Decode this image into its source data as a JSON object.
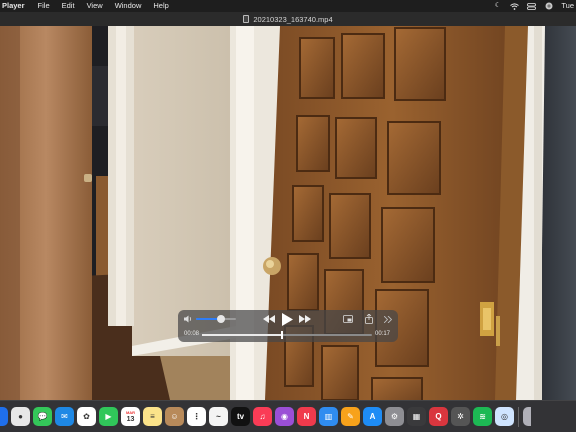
{
  "menubar": {
    "app_name": "Player",
    "menus": [
      "File",
      "Edit",
      "View",
      "Window",
      "Help"
    ],
    "status_icons": [
      "moon-icon",
      "wifi-icon",
      "control-center-icon",
      "siri-icon"
    ],
    "clock": "Tue"
  },
  "window": {
    "title": "20210323_163740.mp4"
  },
  "controller": {
    "volume_level": 0.62,
    "current_time": "00:08",
    "duration": "00:17",
    "progress": 0.47,
    "buttons": [
      "rewind-button",
      "play-button",
      "fast-forward-button",
      "picture-in-picture-button",
      "share-button",
      "more-button"
    ]
  },
  "dock": {
    "apps": [
      {
        "name": "finder-icon-partial",
        "color": "#1f6feb",
        "glyph": ""
      },
      {
        "name": "chrome-icon",
        "color": "#e8e8e8",
        "glyph": "●"
      },
      {
        "name": "messages-icon",
        "color": "#34c759",
        "glyph": "💬"
      },
      {
        "name": "mail-icon",
        "color": "#1e88e5",
        "glyph": "✉"
      },
      {
        "name": "photos-icon",
        "color": "#ffffff",
        "glyph": "✿"
      },
      {
        "name": "facetime-icon",
        "color": "#30c75a",
        "glyph": "▶"
      },
      {
        "name": "calendar-icon",
        "color": "#ffffff",
        "glyph": "13"
      },
      {
        "name": "notes-icon",
        "color": "#fbe38a",
        "glyph": "≡"
      },
      {
        "name": "contacts-icon",
        "color": "#b88a5a",
        "glyph": "☺"
      },
      {
        "name": "reminders-icon",
        "color": "#ffffff",
        "glyph": "⋮"
      },
      {
        "name": "freeform-icon",
        "color": "#f4f4f4",
        "glyph": "~"
      },
      {
        "name": "apple-tv-icon",
        "color": "#111111",
        "glyph": "tv"
      },
      {
        "name": "music-icon",
        "color": "#fa3c56",
        "glyph": "♫"
      },
      {
        "name": "podcasts-icon",
        "color": "#9b4fd6",
        "glyph": "◉"
      },
      {
        "name": "news-icon",
        "color": "#f03a4c",
        "glyph": "N"
      },
      {
        "name": "keynote-icon",
        "color": "#2f8cf0",
        "glyph": "▥"
      },
      {
        "name": "pages-icon",
        "color": "#f7a21b",
        "glyph": "✎"
      },
      {
        "name": "app-store-icon",
        "color": "#1e8cf5",
        "glyph": "A"
      },
      {
        "name": "system-settings-icon",
        "color": "#8e8e93",
        "glyph": "⚙"
      },
      {
        "name": "calculator-icon",
        "color": "#3a3a3c",
        "glyph": "▦"
      },
      {
        "name": "quicktime-icon",
        "color": "#d9363e",
        "glyph": "Q"
      },
      {
        "name": "kaleidoscope-icon",
        "color": "#555555",
        "glyph": "✲"
      },
      {
        "name": "spotify-icon",
        "color": "#1db954",
        "glyph": "≋"
      },
      {
        "name": "preview-icon",
        "color": "#cfe4ff",
        "glyph": "◎"
      },
      {
        "name": "trash-icon-partial",
        "color": "#b0b0b8",
        "glyph": ""
      }
    ],
    "calendar_month": "MAR"
  }
}
